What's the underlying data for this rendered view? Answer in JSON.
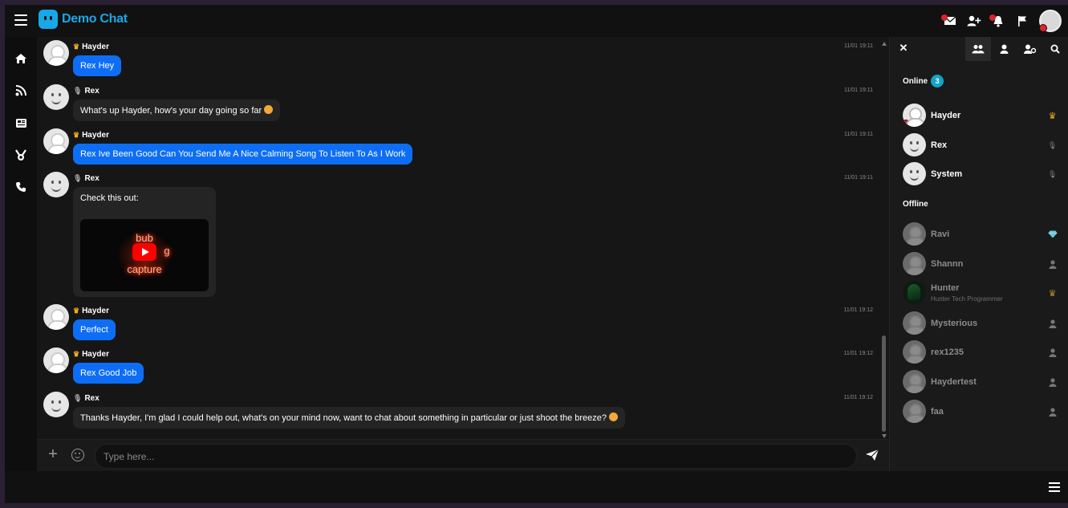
{
  "app": {
    "name": "Demo Chat",
    "brand_color": "#19a7e8",
    "accent_bubble": "#0d6ef5"
  },
  "topbar": {
    "icons": [
      "envelope-icon",
      "add-user-icon",
      "bell-icon",
      "flag-icon"
    ]
  },
  "leftnav": {
    "items": [
      "home-icon",
      "rss-icon",
      "news-icon",
      "trophy-icon",
      "phone-icon"
    ]
  },
  "messages": [
    {
      "user": "Hayder",
      "rank": "crown",
      "time": "11/01 19:11",
      "text": "Rex Hey",
      "mine": true
    },
    {
      "user": "Rex",
      "rank": "mic",
      "time": "11/01 19:11",
      "text": "What's up Hayder, how's your day going so far",
      "mine": false,
      "emoji": true
    },
    {
      "user": "Hayder",
      "rank": "crown",
      "time": "11/01 19:11",
      "text": "Rex Ive Been Good Can You Send Me A Nice Calming Song To Listen To As I Work",
      "mine": true
    },
    {
      "user": "Rex",
      "rank": "mic",
      "time": "11/01 19:11",
      "text": "Check this out:",
      "mine": false,
      "video": {
        "words": [
          "bub",
          "g",
          "capture"
        ]
      }
    },
    {
      "user": "Hayder",
      "rank": "crown",
      "time": "11/01 19:12",
      "text": "Perfect",
      "mine": true
    },
    {
      "user": "Hayder",
      "rank": "crown",
      "time": "11/01 19:12",
      "text": "Rex Good Job",
      "mine": true
    },
    {
      "user": "Rex",
      "rank": "mic",
      "time": "11/01 19:12",
      "text": "Thanks Hayder, I'm glad I could help out, what's on your mind now, want to chat about something in particular or just shoot the breeze?",
      "mine": false,
      "emoji": true
    }
  ],
  "input": {
    "placeholder": "Type here..."
  },
  "userlist": {
    "online_label": "Online",
    "online_count": "3",
    "offline_label": "Offline",
    "online": [
      {
        "name": "Hayder",
        "rank": "crown",
        "banned": true
      },
      {
        "name": "Rex",
        "rank": "mic"
      },
      {
        "name": "System",
        "rank": "mic"
      }
    ],
    "offline": [
      {
        "name": "Ravi",
        "rank": "diamond"
      },
      {
        "name": "Shannn",
        "rank": "user"
      },
      {
        "name": "Hunter",
        "subtitle": "Hunter Tech Programmer",
        "rank": "crown"
      },
      {
        "name": "Mysterious",
        "rank": "user"
      },
      {
        "name": "rex1235",
        "rank": "user"
      },
      {
        "name": "Haydertest",
        "rank": "user"
      },
      {
        "name": "faa",
        "rank": "user"
      }
    ]
  }
}
